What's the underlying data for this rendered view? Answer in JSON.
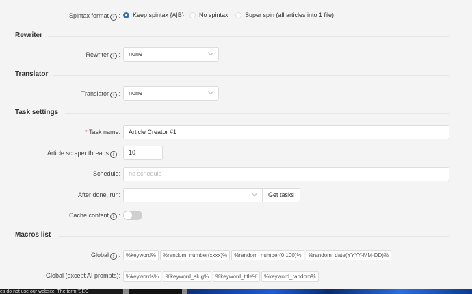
{
  "spintax": {
    "label": "Spintax format",
    "options": [
      {
        "label": "Keep spintax {A|B}",
        "selected": true
      },
      {
        "label": "No spintax",
        "selected": false
      },
      {
        "label": "Super spin (all articles into 1 file)",
        "selected": false
      }
    ]
  },
  "rewriter": {
    "heading": "Rewriter",
    "label": "Rewriter",
    "value": "none"
  },
  "translator": {
    "heading": "Translator",
    "label": "Translator",
    "value": "none"
  },
  "task": {
    "heading": "Task settings",
    "name_label": "Task name:",
    "name_value": "Article Creator #1",
    "threads_label": "Article scraper threads",
    "threads_value": "10",
    "schedule_label": "Schedule:",
    "schedule_placeholder": "no schedule",
    "after_label": "After done, run:",
    "after_value": "",
    "get_tasks": "Get tasks",
    "cache_label": "Cache content",
    "cache_on": false
  },
  "macros": {
    "heading": "Macros list",
    "global_label": "Global",
    "global_tags": [
      "%keyword%",
      "%random_number(xxxx)%",
      "%random_number(0,100)%",
      "%random_date(YYYY-MM-DD)%"
    ],
    "except_label": "Global (except AI prompts):",
    "except_tags": [
      "%keywords%",
      "%keyword_slug%",
      "%keyword_title%",
      "%keyword_random%"
    ]
  },
  "taskbar": {
    "snippet": "es do not use our website. The term 'SEO"
  },
  "colors": {
    "accent": "#3c6fb5",
    "background": "#f4f4f4"
  }
}
